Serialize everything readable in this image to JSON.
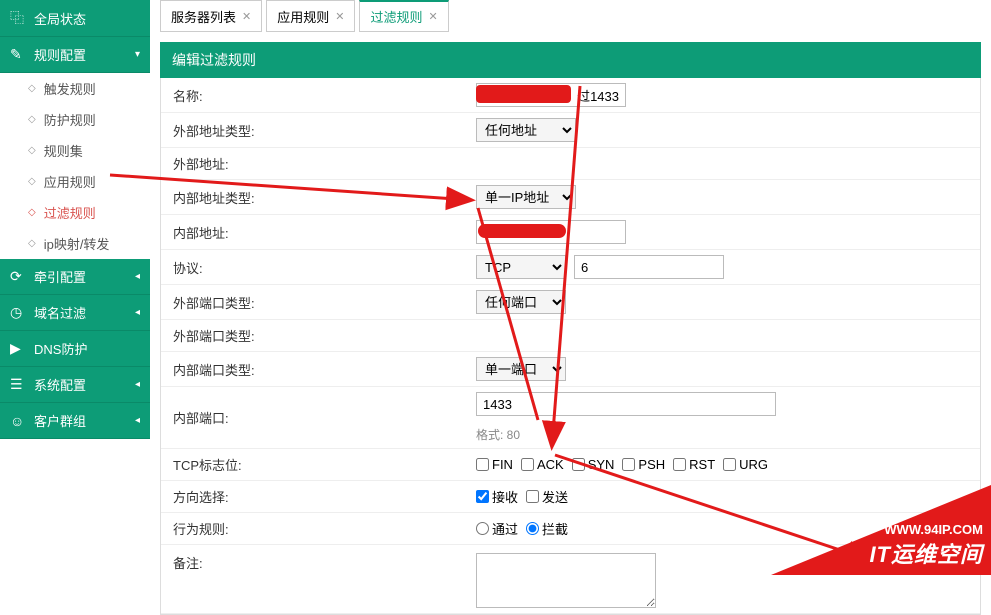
{
  "sidebar": {
    "global_status": "全局状态",
    "rule_config": "规则配置",
    "sub": {
      "trigger": "触发规则",
      "protect": "防护规则",
      "ruleset": "规则集",
      "app_rule": "应用规则",
      "filter_rule": "过滤规则",
      "ip_mapping": "ip映射/转发"
    },
    "traction": "牵引配置",
    "domain_filter": "域名过滤",
    "dns_protect": "DNS防护",
    "sys_config": "系统配置",
    "customer": "客户群组"
  },
  "tabs": {
    "server_list": "服务器列表",
    "app_rule": "应用规则",
    "filter_rule": "过滤规则"
  },
  "panel": {
    "header": "编辑过滤规则"
  },
  "form": {
    "name_label": "名称:",
    "name_value_suffix": "过1433",
    "ext_addr_type_label": "外部地址类型:",
    "ext_addr_type_value": "任何地址",
    "ext_addr_label": "外部地址:",
    "int_addr_type_label": "内部地址类型:",
    "int_addr_type_value": "单一IP地址",
    "int_addr_label": "内部地址:",
    "protocol_label": "协议:",
    "protocol_value": "TCP",
    "protocol_num": "6",
    "ext_port_type_label": "外部端口类型:",
    "ext_port_type_value": "任何端口",
    "ext_port_type2_label": "外部端口类型:",
    "int_port_type_label": "内部端口类型:",
    "int_port_type_value": "单一端口",
    "int_port_label": "内部端口:",
    "int_port_value": "1433",
    "int_port_hint": "格式: 80",
    "tcp_flags_label": "TCP标志位:",
    "flags": {
      "fin": "FIN",
      "ack": "ACK",
      "syn": "SYN",
      "psh": "PSH",
      "rst": "RST",
      "urg": "URG"
    },
    "direction_label": "方向选择:",
    "direction": {
      "recv": "接收",
      "send": "发送"
    },
    "action_label": "行为规则:",
    "action": {
      "pass": "通过",
      "block": "拦截"
    },
    "remark_label": "备注:"
  },
  "corner": {
    "url": "WWW.94IP.COM",
    "title": "IT运维空间"
  }
}
